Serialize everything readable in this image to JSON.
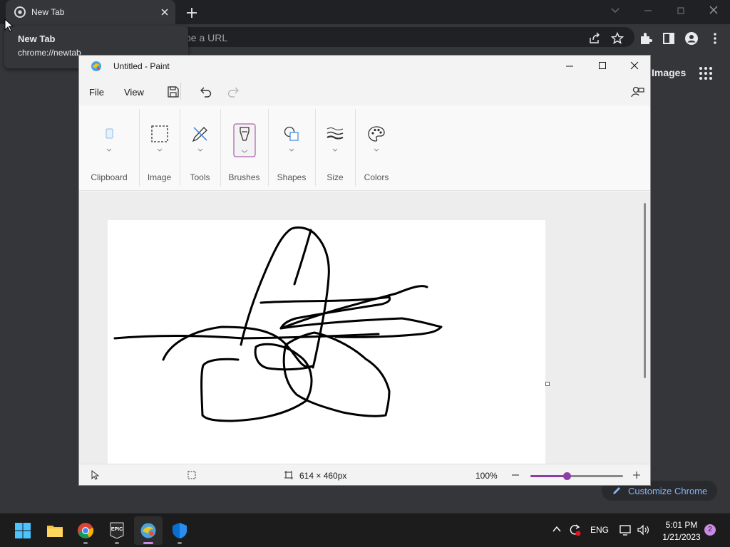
{
  "chrome": {
    "tab": {
      "title": "New Tab"
    },
    "omnibox": {
      "placeholder_visible": "pe a URL"
    },
    "tooltip": {
      "title": "New Tab",
      "url": "chrome://newtab"
    },
    "content": {
      "images_link": "Images",
      "customize_label": "Customize Chrome"
    }
  },
  "paint": {
    "title": "Untitled - Paint",
    "menu": {
      "file": "File",
      "view": "View"
    },
    "ribbon": {
      "groups": [
        "Clipboard",
        "Image",
        "Tools",
        "Brushes",
        "Shapes",
        "Size",
        "Colors"
      ]
    },
    "status": {
      "canvas_size": "614 × 460px",
      "zoom": "100%",
      "zoom_level": 0.39
    }
  },
  "taskbar": {
    "apps": [
      "start-button",
      "file-explorer",
      "google-chrome",
      "epic-games",
      "paint",
      "windows-security"
    ],
    "epic_text": "EPIC",
    "language": "ENG",
    "time": "5:01 PM",
    "date": "1/21/2023",
    "notification_count": "2"
  },
  "colors": {
    "accent": "#8b3fa6",
    "chrome_bg": "#35363a",
    "link": "#8ab4f8"
  }
}
